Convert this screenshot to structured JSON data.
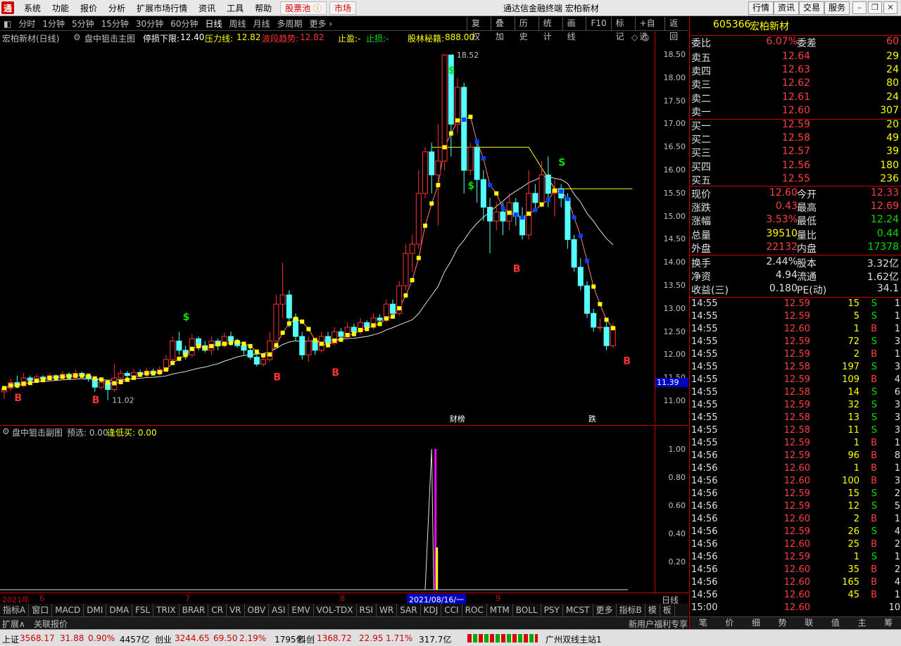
{
  "menubar": {
    "logo": "通",
    "items": [
      "系统",
      "功能",
      "报价",
      "分析",
      "扩展市场行情",
      "资讯",
      "工具",
      "帮助"
    ],
    "pool": "股票池",
    "market": "市场",
    "title": "通达信金融终端  宏柏新材",
    "right_buttons": [
      "行情",
      "资讯",
      "交易",
      "服务"
    ]
  },
  "toolbar": {
    "periods": [
      "分时",
      "1分钟",
      "5分钟",
      "15分钟",
      "30分钟",
      "60分钟",
      "日线",
      "周线",
      "月线",
      "多周期",
      "更多"
    ],
    "active": "日线",
    "right": [
      "复权",
      "叠加",
      "历史",
      "统计",
      "画线",
      "F10",
      "标记",
      "+自选",
      "返回"
    ]
  },
  "info": {
    "name": "宏柏新材(日线)",
    "indicator": "盘中狙击主图",
    "stop_label": "停损下限:",
    "stop_val": "12.40",
    "press_label": "压力线:",
    "press_val": "12.82",
    "wave_label": "波段趋势:",
    "wave_val": "12.82",
    "profit": "止盈:-",
    "loss": "止损:-",
    "secret_label": "股林秘籍:",
    "secret_val": "888.00"
  },
  "chart_data": {
    "type": "candlestick",
    "ylim": [
      10.8,
      18.7
    ],
    "yticks": [
      "18.50",
      "18.00",
      "17.50",
      "17.00",
      "16.50",
      "16.00",
      "15.50",
      "15.00",
      "14.50",
      "14.00",
      "13.50",
      "13.00",
      "12.50",
      "12.00",
      "11.50",
      "11.00"
    ],
    "current_price_label": "11.39",
    "high_label": "18.52",
    "low_label": "11.02",
    "annotations": [
      "财榜",
      "跌"
    ],
    "candles": [
      [
        11.2,
        11.28,
        11.05,
        11.3
      ],
      [
        11.28,
        11.4,
        11.22,
        11.48
      ],
      [
        11.4,
        11.33,
        11.28,
        11.55
      ],
      [
        11.33,
        11.5,
        11.3,
        11.6
      ],
      [
        11.5,
        11.45,
        11.38,
        11.55
      ],
      [
        11.45,
        11.52,
        11.4,
        11.58
      ],
      [
        11.52,
        11.48,
        11.4,
        11.56
      ],
      [
        11.48,
        11.55,
        11.42,
        11.6
      ],
      [
        11.55,
        11.5,
        11.45,
        11.58
      ],
      [
        11.5,
        11.58,
        11.45,
        11.65
      ],
      [
        11.58,
        11.52,
        11.48,
        11.62
      ],
      [
        11.52,
        11.6,
        11.45,
        11.68
      ],
      [
        11.6,
        11.55,
        11.5,
        11.64
      ],
      [
        11.55,
        11.48,
        11.42,
        11.58
      ],
      [
        11.48,
        11.3,
        11.2,
        11.52
      ],
      [
        11.3,
        11.4,
        11.25,
        11.45
      ],
      [
        11.4,
        11.25,
        11.02,
        11.45
      ],
      [
        11.25,
        11.5,
        11.2,
        11.8
      ],
      [
        11.5,
        11.6,
        11.45,
        11.68
      ],
      [
        11.6,
        11.55,
        11.48,
        11.65
      ],
      [
        11.55,
        11.62,
        11.5,
        11.7
      ],
      [
        11.62,
        11.58,
        11.52,
        11.68
      ],
      [
        11.58,
        11.65,
        11.52,
        11.72
      ],
      [
        11.65,
        11.6,
        11.55,
        11.7
      ],
      [
        11.6,
        11.68,
        11.55,
        11.75
      ],
      [
        11.68,
        11.9,
        11.65,
        12.0
      ],
      [
        11.9,
        12.3,
        11.85,
        12.4
      ],
      [
        12.3,
        12.1,
        12.0,
        12.5
      ],
      [
        12.1,
        12.0,
        11.9,
        12.2
      ],
      [
        12.0,
        12.35,
        11.95,
        12.45
      ],
      [
        12.35,
        12.2,
        12.1,
        12.4
      ],
      [
        12.2,
        12.1,
        12.05,
        12.3
      ],
      [
        12.1,
        12.3,
        12.0,
        12.4
      ],
      [
        12.3,
        12.2,
        12.1,
        12.35
      ],
      [
        12.2,
        12.4,
        12.15,
        12.48
      ],
      [
        12.4,
        12.3,
        12.2,
        12.5
      ],
      [
        12.3,
        12.2,
        12.15,
        12.35
      ],
      [
        12.2,
        12.1,
        12.0,
        12.25
      ],
      [
        12.1,
        11.95,
        11.9,
        12.15
      ],
      [
        11.95,
        11.8,
        11.75,
        12.0
      ],
      [
        11.8,
        11.9,
        11.75,
        12.0
      ],
      [
        11.9,
        12.3,
        11.85,
        12.5
      ],
      [
        12.3,
        13.1,
        12.25,
        13.3
      ],
      [
        13.1,
        13.3,
        12.8,
        14.0
      ],
      [
        13.3,
        12.8,
        12.6,
        13.4
      ],
      [
        12.8,
        12.4,
        12.3,
        12.9
      ],
      [
        12.4,
        12.0,
        11.9,
        12.5
      ],
      [
        12.0,
        12.3,
        11.85,
        12.4
      ],
      [
        12.3,
        12.1,
        12.0,
        12.35
      ],
      [
        12.1,
        12.4,
        12.05,
        12.5
      ],
      [
        12.4,
        12.25,
        12.2,
        12.5
      ],
      [
        12.25,
        12.5,
        12.2,
        12.6
      ],
      [
        12.5,
        12.4,
        12.35,
        12.58
      ],
      [
        12.4,
        12.6,
        12.35,
        12.7
      ],
      [
        12.6,
        12.5,
        12.45,
        12.68
      ],
      [
        12.5,
        12.7,
        12.45,
        12.8
      ],
      [
        12.7,
        12.6,
        12.55,
        12.75
      ],
      [
        12.6,
        12.8,
        12.55,
        12.9
      ],
      [
        12.8,
        12.75,
        12.7,
        12.88
      ],
      [
        12.75,
        13.1,
        12.7,
        13.2
      ],
      [
        13.1,
        12.9,
        12.8,
        13.2
      ],
      [
        12.9,
        13.5,
        12.85,
        13.6
      ],
      [
        13.5,
        14.2,
        13.4,
        14.4
      ],
      [
        14.2,
        14.4,
        13.8,
        14.6
      ],
      [
        14.4,
        15.5,
        14.3,
        16.0
      ],
      [
        15.5,
        16.4,
        15.4,
        16.5
      ],
      [
        16.4,
        15.9,
        15.5,
        16.6
      ],
      [
        15.9,
        16.2,
        14.8,
        17.0
      ],
      [
        16.2,
        18.5,
        16.0,
        18.52
      ],
      [
        18.5,
        17.0,
        16.3,
        18.4
      ],
      [
        17.0,
        17.8,
        16.8,
        18.0
      ],
      [
        17.8,
        16.0,
        15.5,
        17.9
      ],
      [
        16.0,
        16.5,
        15.9,
        16.6
      ],
      [
        16.5,
        15.8,
        15.3,
        16.6
      ],
      [
        15.8,
        15.2,
        14.9,
        16.0
      ],
      [
        15.2,
        14.9,
        14.2,
        15.4
      ],
      [
        14.9,
        15.1,
        14.7,
        15.3
      ],
      [
        15.1,
        14.9,
        14.6,
        15.3
      ],
      [
        14.9,
        15.3,
        14.7,
        15.5
      ],
      [
        15.3,
        15.0,
        14.8,
        15.4
      ],
      [
        15.0,
        14.6,
        14.5,
        15.2
      ],
      [
        14.6,
        15.5,
        14.5,
        16.0
      ],
      [
        15.5,
        15.3,
        15.1,
        15.7
      ],
      [
        15.3,
        15.9,
        15.2,
        16.2
      ],
      [
        15.9,
        15.5,
        15.2,
        16.3
      ],
      [
        15.5,
        15.6,
        15.0,
        15.8
      ],
      [
        15.6,
        15.4,
        15.2,
        15.7
      ],
      [
        15.4,
        14.5,
        14.3,
        15.5
      ],
      [
        14.5,
        13.9,
        13.8,
        14.6
      ],
      [
        13.9,
        13.5,
        13.4,
        14.1
      ],
      [
        13.5,
        12.9,
        12.8,
        13.6
      ],
      [
        12.9,
        12.6,
        12.5,
        13.0
      ],
      [
        12.6,
        12.6,
        12.5,
        12.8
      ],
      [
        12.6,
        12.2,
        12.1,
        12.7
      ],
      [
        12.2,
        12.6,
        12.15,
        12.69
      ]
    ],
    "sub_label": "盘中狙击副图",
    "sub_pre": "预选: 0.00",
    "sub_buy": "逢低买: 0.00",
    "sub_yticks": [
      "1.00",
      "0.80",
      "0.60",
      "0.40",
      "0.20"
    ],
    "sub_spike_at": 66
  },
  "xaxis": {
    "year": "2021年",
    "labels": [
      "6",
      "7",
      "8",
      "9"
    ],
    "cursor": "2021/08/16/一",
    "period": "日线"
  },
  "idxbar": [
    "指标A",
    "窗口",
    "MACD",
    "DMI",
    "DMA",
    "FSL",
    "TRIX",
    "BRAR",
    "CR",
    "VR",
    "OBV",
    "ASI",
    "EMV",
    "VOL-TDX",
    "RSI",
    "WR",
    "SAR",
    "KDJ",
    "CCI",
    "ROC",
    "MTM",
    "BOLL",
    "PSY",
    "MCST",
    "更多",
    "指标B",
    "模",
    "板"
  ],
  "extbar": {
    "ext": "扩展∧",
    "link": "关联报价",
    "promo": "新用户福利专享"
  },
  "quote": {
    "code": "605366",
    "name": "宏柏新材",
    "ratio_label": "委比",
    "ratio": "6.07%",
    "diff_label": "委差",
    "diff": "60",
    "sells": [
      [
        "卖五",
        "12.64",
        "29"
      ],
      [
        "卖四",
        "12.63",
        "24"
      ],
      [
        "卖三",
        "12.62",
        "80"
      ],
      [
        "卖二",
        "12.61",
        "24"
      ],
      [
        "卖一",
        "12.60",
        "307"
      ]
    ],
    "buys": [
      [
        "买一",
        "12.59",
        "20"
      ],
      [
        "买二",
        "12.58",
        "49"
      ],
      [
        "买三",
        "12.57",
        "39"
      ],
      [
        "买四",
        "12.56",
        "180"
      ],
      [
        "买五",
        "12.55",
        "236"
      ]
    ],
    "stats": [
      [
        "现价",
        "12.60",
        "今开",
        "12.33"
      ],
      [
        "涨跌",
        "0.43",
        "最高",
        "12.69"
      ],
      [
        "涨幅",
        "3.53%",
        "最低",
        "12.24"
      ],
      [
        "总量",
        "39510",
        "量比",
        "0.44"
      ],
      [
        "外盘",
        "22132",
        "内盘",
        "17378"
      ]
    ],
    "stats2": [
      [
        "换手",
        "2.44%",
        "股本",
        "3.32亿"
      ],
      [
        "净资",
        "4.94",
        "流通",
        "1.62亿"
      ],
      [
        "收益(三)",
        "0.180",
        "PE(动)",
        "34.1"
      ]
    ],
    "ticks": [
      [
        "14:55",
        "12.59",
        "15",
        "S",
        "1"
      ],
      [
        "14:55",
        "12.59",
        "5",
        "S",
        "1"
      ],
      [
        "14:55",
        "12.60",
        "1",
        "B",
        "1"
      ],
      [
        "14:55",
        "12.59",
        "72",
        "S",
        "3"
      ],
      [
        "14:55",
        "12.59",
        "2",
        "B",
        "1"
      ],
      [
        "14:55",
        "12.58",
        "197",
        "S",
        "3"
      ],
      [
        "14:55",
        "12.59",
        "109",
        "B",
        "4"
      ],
      [
        "14:55",
        "12.58",
        "14",
        "S",
        "6"
      ],
      [
        "14:55",
        "12.59",
        "32",
        "S",
        "3"
      ],
      [
        "14:55",
        "12.58",
        "13",
        "S",
        "3"
      ],
      [
        "14:55",
        "12.58",
        "11",
        "S",
        "3"
      ],
      [
        "14:55",
        "12.59",
        "1",
        "B",
        "1"
      ],
      [
        "14:56",
        "12.59",
        "96",
        "B",
        "8"
      ],
      [
        "14:56",
        "12.60",
        "1",
        "B",
        "1"
      ],
      [
        "14:56",
        "12.60",
        "100",
        "B",
        "3"
      ],
      [
        "14:56",
        "12.59",
        "15",
        "S",
        "2"
      ],
      [
        "14:56",
        "12.59",
        "12",
        "S",
        "5"
      ],
      [
        "14:56",
        "12.60",
        "2",
        "B",
        "1"
      ],
      [
        "14:56",
        "12.59",
        "26",
        "S",
        "4"
      ],
      [
        "14:56",
        "12.60",
        "25",
        "B",
        "2"
      ],
      [
        "14:56",
        "12.59",
        "1",
        "S",
        "1"
      ],
      [
        "14:56",
        "12.60",
        "35",
        "B",
        "2"
      ],
      [
        "14:56",
        "12.60",
        "165",
        "B",
        "4"
      ],
      [
        "14:56",
        "12.60",
        "45",
        "B",
        "1"
      ],
      [
        "15:00",
        "12.60",
        "",
        "",
        "10"
      ]
    ],
    "bottom_tabs": [
      "笔",
      "价",
      "细",
      "势",
      "联",
      "值",
      "主",
      "筹"
    ]
  },
  "statusbar": {
    "items": [
      "上证",
      "3568.17",
      "31.88",
      "0.90%",
      "4457亿",
      "创业",
      "3244.65",
      "69.50",
      "2.19%",
      "1795亿",
      "科创",
      "1368.72",
      "22.95",
      "1.71%",
      "317.7亿"
    ],
    "server": "广州双线主站1"
  },
  "colors": {
    "up": "#ff3232",
    "down": "#54ffff",
    "axis": "#c00000",
    "yellow": "#ffff00"
  }
}
